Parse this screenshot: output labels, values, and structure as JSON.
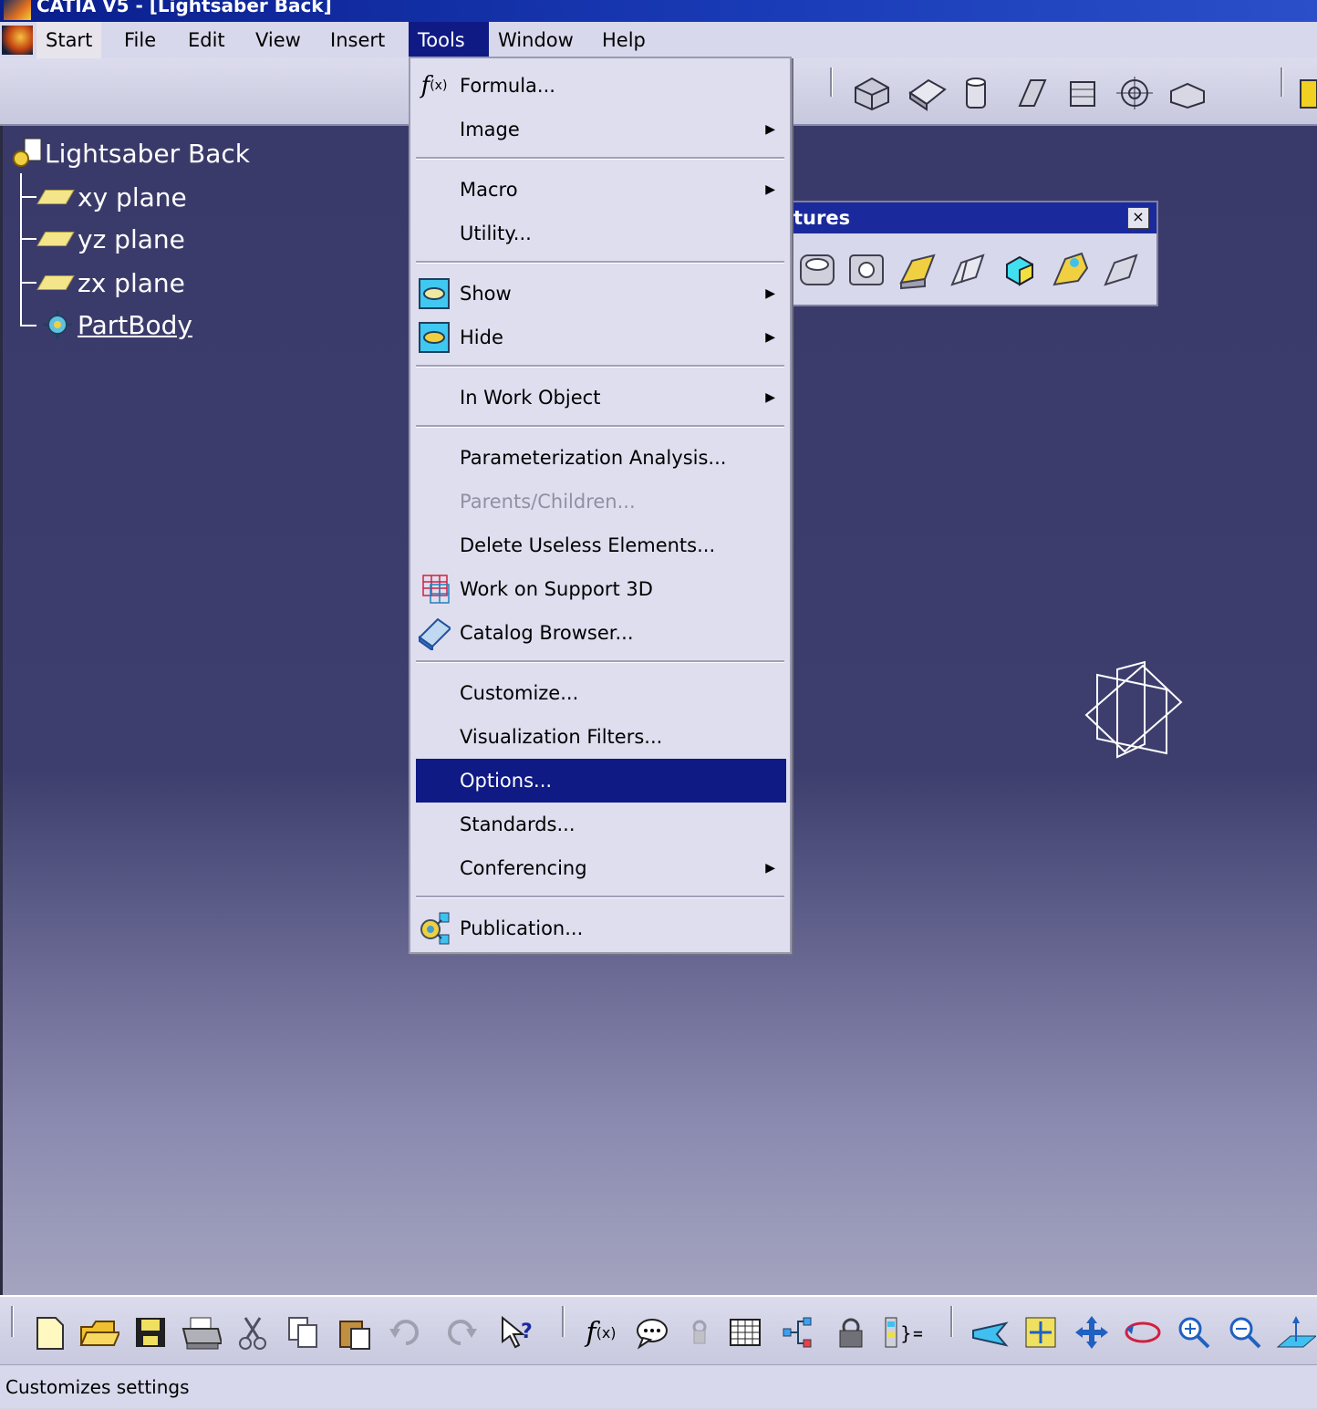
{
  "window": {
    "title": "CATIA V5 - [Lightsaber Back]"
  },
  "menubar": {
    "items": [
      {
        "label": "Start"
      },
      {
        "label": "File"
      },
      {
        "label": "Edit"
      },
      {
        "label": "View"
      },
      {
        "label": "Insert"
      },
      {
        "label": "Tools",
        "active": true
      },
      {
        "label": "Window"
      },
      {
        "label": "Help"
      }
    ]
  },
  "tree": {
    "root": "Lightsaber Back",
    "children": [
      {
        "label": "xy plane",
        "icon": "plane-icon"
      },
      {
        "label": "yz plane",
        "icon": "plane-icon"
      },
      {
        "label": "zx plane",
        "icon": "plane-icon"
      },
      {
        "label": "PartBody",
        "icon": "partbody-icon"
      }
    ]
  },
  "features_toolbar": {
    "title": "tures",
    "close": "×"
  },
  "tools_menu": {
    "items": [
      {
        "label": "Formula...",
        "icon": "formula-icon"
      },
      {
        "label": "Image",
        "submenu": true
      },
      {
        "label": "Macro",
        "submenu": true
      },
      {
        "label": "Utility..."
      },
      {
        "label": "Show",
        "submenu": true,
        "icon": "show-icon"
      },
      {
        "label": "Hide",
        "submenu": true,
        "icon": "hide-icon"
      },
      {
        "label": "In Work Object",
        "submenu": true
      },
      {
        "label": "Parameterization Analysis..."
      },
      {
        "label": "Parents/Children...",
        "disabled": true
      },
      {
        "label": "Delete Useless Elements..."
      },
      {
        "label": "Work on Support 3D",
        "icon": "support-3d-icon"
      },
      {
        "label": "Catalog Browser...",
        "icon": "catalog-icon"
      },
      {
        "label": "Customize..."
      },
      {
        "label": "Visualization Filters..."
      },
      {
        "label": "Options...",
        "selected": true
      },
      {
        "label": "Standards..."
      },
      {
        "label": "Conferencing",
        "submenu": true
      },
      {
        "label": "Publication...",
        "icon": "publication-icon"
      }
    ],
    "submenu_arrow": "▶"
  },
  "status": {
    "text": "Customizes settings"
  },
  "colors": {
    "menu_highlight": "#0f1a85",
    "title_bar": "#0a1e8c"
  }
}
